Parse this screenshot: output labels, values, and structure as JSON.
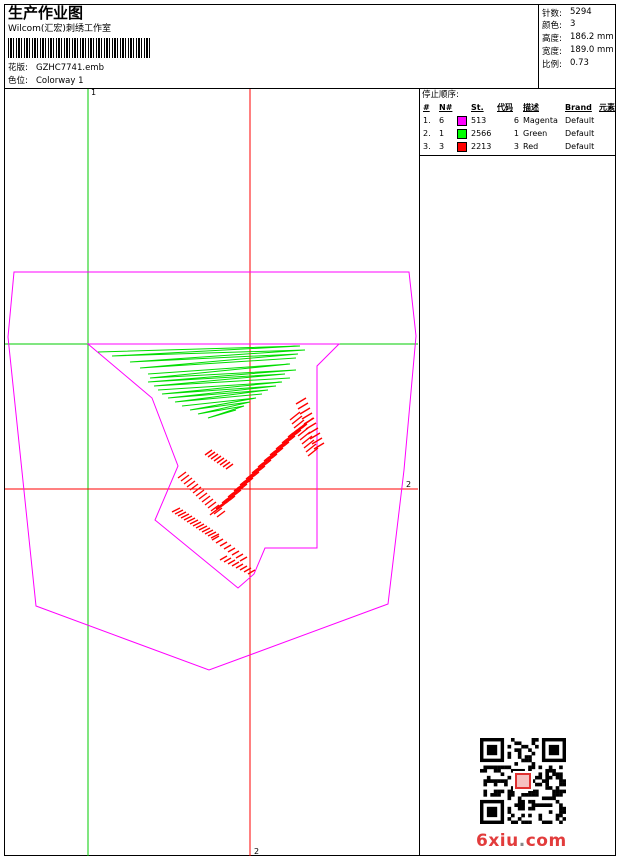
{
  "header": {
    "title": "生产作业图",
    "studio": "Wilcom(汇宏)刺绣工作室",
    "design_label": "花版:",
    "design_value": "GZHC7741.emb",
    "colorway_label": "色位:",
    "colorway_value": "Colorway 1"
  },
  "specs": [
    {
      "label": "针数:",
      "value": "5294"
    },
    {
      "label": "颜色:",
      "value": "3"
    },
    {
      "label": "高度:",
      "value": "186.2 mm"
    },
    {
      "label": "宽度:",
      "value": "189.0 mm"
    },
    {
      "label": "比例:",
      "value": "0.73"
    }
  ],
  "stop_sequence": {
    "title": "停止顺序:",
    "headers": [
      "#",
      "N#",
      "St.",
      "代码",
      "描述",
      "Brand",
      "元素"
    ],
    "rows": [
      {
        "seq": "1.",
        "needle": "6",
        "color": "#ff00ff",
        "stitches": "513",
        "code": "6",
        "desc": "Magenta",
        "brand": "Default"
      },
      {
        "seq": "2.",
        "needle": "1",
        "color": "#00ff00",
        "stitches": "2566",
        "code": "1",
        "desc": "Green",
        "brand": "Default"
      },
      {
        "seq": "3.",
        "needle": "3",
        "color": "#ff0000",
        "stitches": "2213",
        "code": "3",
        "desc": "Red",
        "brand": "Default"
      }
    ]
  },
  "guides": {
    "green_vertical_label": "1",
    "red_horizontal_label": "2",
    "red_vertical_label": "2",
    "green_color": "#00cc00",
    "red_color": "#ff0000",
    "outline_color": "#ff00ff"
  },
  "watermark": {
    "site_main": "6xiu",
    "site_dot": ".",
    "site_tld": "com"
  }
}
